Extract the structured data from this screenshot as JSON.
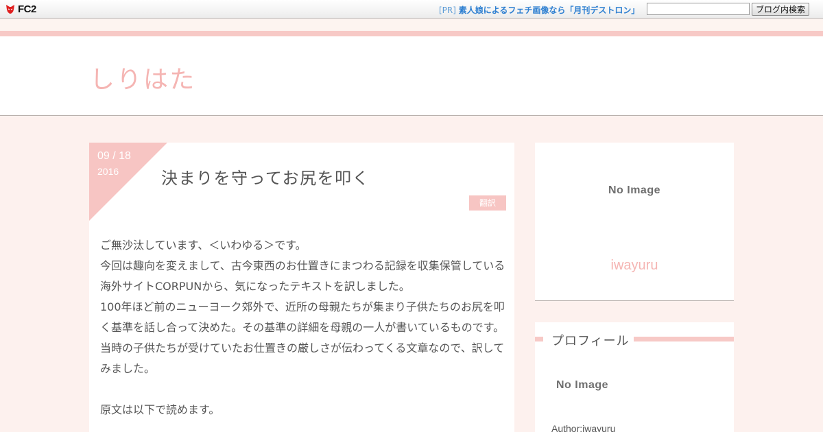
{
  "topbar": {
    "logo_text": "FC2",
    "pr_tag": "[PR]",
    "pr_link": "素人娘によるフェチ画像なら「月刊デストロン」",
    "search_value": "",
    "search_button": "ブログ内検索"
  },
  "blog": {
    "title": "しりはた"
  },
  "article": {
    "date_md": "09 /   18",
    "date_year": "2016",
    "title": "決まりを守ってお尻を叩く",
    "category": "翻訳",
    "paragraphs": [
      "ご無沙汰しています、＜いわゆる＞です。",
      "今回は趣向を変えまして、古今東西のお仕置きにまつわる記録を収集保管している海外サイトCORPUNから、気になったテキストを訳しました。",
      "100年ほど前のニューヨーク郊外で、近所の母親たちが集まり子供たちのお尻を叩く基準を話し合って決めた。その基準の詳細を母親の一人が書いているものです。",
      "当時の子供たちが受けていたお仕置きの厳しさが伝わってくる文章なので、訳してみました。",
      "原文は以下で読めます。"
    ]
  },
  "sidebar": {
    "card_noimage": "No Image",
    "card_author": "iwayuru",
    "profile_title": "プロフィール",
    "profile_noimage": "No Image",
    "profile_author": "Author:iwayuru"
  },
  "colors": {
    "accent_pink": "#f7c5c3",
    "title_pink": "#f5b5b3",
    "link_blue": "#2d7fd1",
    "background": "#fdf1ee"
  }
}
